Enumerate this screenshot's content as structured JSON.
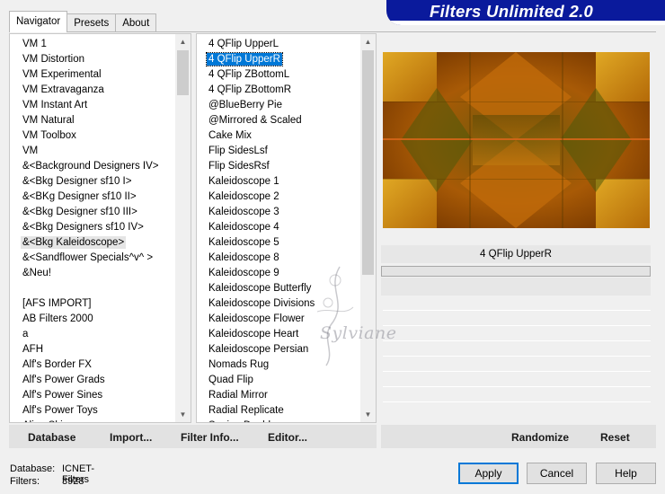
{
  "banner": {
    "title": "Filters Unlimited 2.0"
  },
  "tabs": [
    "Navigator",
    "Presets",
    "About"
  ],
  "categories": [
    "VM 1",
    "VM Distortion",
    "VM Experimental",
    "VM Extravaganza",
    "VM Instant Art",
    "VM Natural",
    "VM Toolbox",
    "VM",
    "&<Background Designers IV>",
    "&<Bkg Designer sf10 I>",
    "&<BKg Designer sf10 II>",
    "&<Bkg Designer sf10 III>",
    "&<Bkg Designers sf10 IV>",
    "&<Bkg Kaleidoscope>",
    "&<Sandflower Specials^v^ >",
    "&Neu!",
    "",
    "[AFS IMPORT]",
    "AB Filters 2000",
    "a",
    "AFH",
    "Alf's Border FX",
    "Alf's Power Grads",
    "Alf's Power Sines",
    "Alf's Power Toys",
    "Alien Skin"
  ],
  "selected_category_index": 13,
  "filters": [
    "4 QFlip UpperL",
    "4 QFlip UpperR",
    "4 QFlip ZBottomL",
    "4 QFlip ZBottomR",
    "@BlueBerry Pie",
    "@Mirrored & Scaled",
    "Cake Mix",
    "Flip SidesLsf",
    "Flip SidesRsf",
    "Kaleidoscope 1",
    "Kaleidoscope 2",
    "Kaleidoscope 3",
    "Kaleidoscope 4",
    "Kaleidoscope 5",
    "Kaleidoscope 8",
    "Kaleidoscope 9",
    "Kaleidoscope Butterfly",
    "Kaleidoscope Divisions",
    "Kaleidoscope Flower",
    "Kaleidoscope Heart",
    "Kaleidoscope Persian",
    "Nomads Rug",
    "Quad Flip",
    "Radial Mirror",
    "Radial Replicate",
    "Seeing Double"
  ],
  "selected_filter_index": 1,
  "preview": {
    "filter_name": "4 QFlip UpperR"
  },
  "watermark": "Sylviane",
  "bottom_left_buttons": [
    "Database",
    "Import...",
    "Filter Info...",
    "Editor..."
  ],
  "bottom_right_buttons": [
    "Randomize",
    "Reset"
  ],
  "database_info": {
    "database_label": "Database:",
    "database_value": "ICNET-Filters",
    "filters_label": "Filters:",
    "filters_value": "3928"
  },
  "dialog_buttons": {
    "apply": "Apply",
    "cancel": "Cancel",
    "help": "Help"
  },
  "colors": {
    "banner": "#0a1a9c",
    "selection": "#0078d7",
    "preview_dark": "#8a4200",
    "preview_gold": "#d29a1a"
  }
}
